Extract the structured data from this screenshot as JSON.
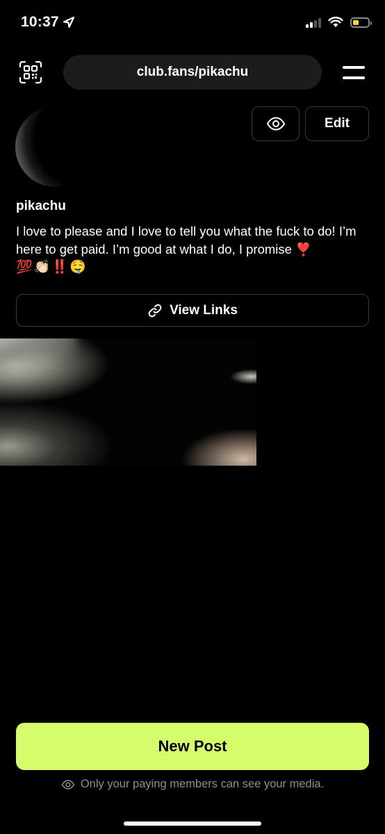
{
  "status_bar": {
    "time": "10:37",
    "icons": [
      "location-arrow-icon",
      "signal-icon",
      "wifi-icon",
      "battery-icon"
    ],
    "battery_level": 0.4,
    "battery_color": "#f7d84a",
    "signal_bars_active": 2,
    "signal_bars_total": 4
  },
  "header": {
    "qr_icon": "qr-code-icon",
    "url": "club.fans/pikachu",
    "menu_icon": "hamburger-menu-icon"
  },
  "profile": {
    "preview_icon": "eye-icon",
    "edit_label": "Edit",
    "username": "pikachu",
    "bio": "I love to please and I love to tell you what the fuck to do! I’m here to get paid. I’m good at what I do, I promise ❣️",
    "bio_emojis": [
      "💯",
      "👏🏻",
      "‼️",
      "🤤"
    ]
  },
  "links_button": {
    "icon": "link-icon",
    "label": "View Links"
  },
  "footer": {
    "new_post_label": "New Post",
    "privacy_icon": "eye-icon",
    "privacy_text": "Only your paying members can see your media.",
    "accent_color": "#d4fc6b"
  }
}
